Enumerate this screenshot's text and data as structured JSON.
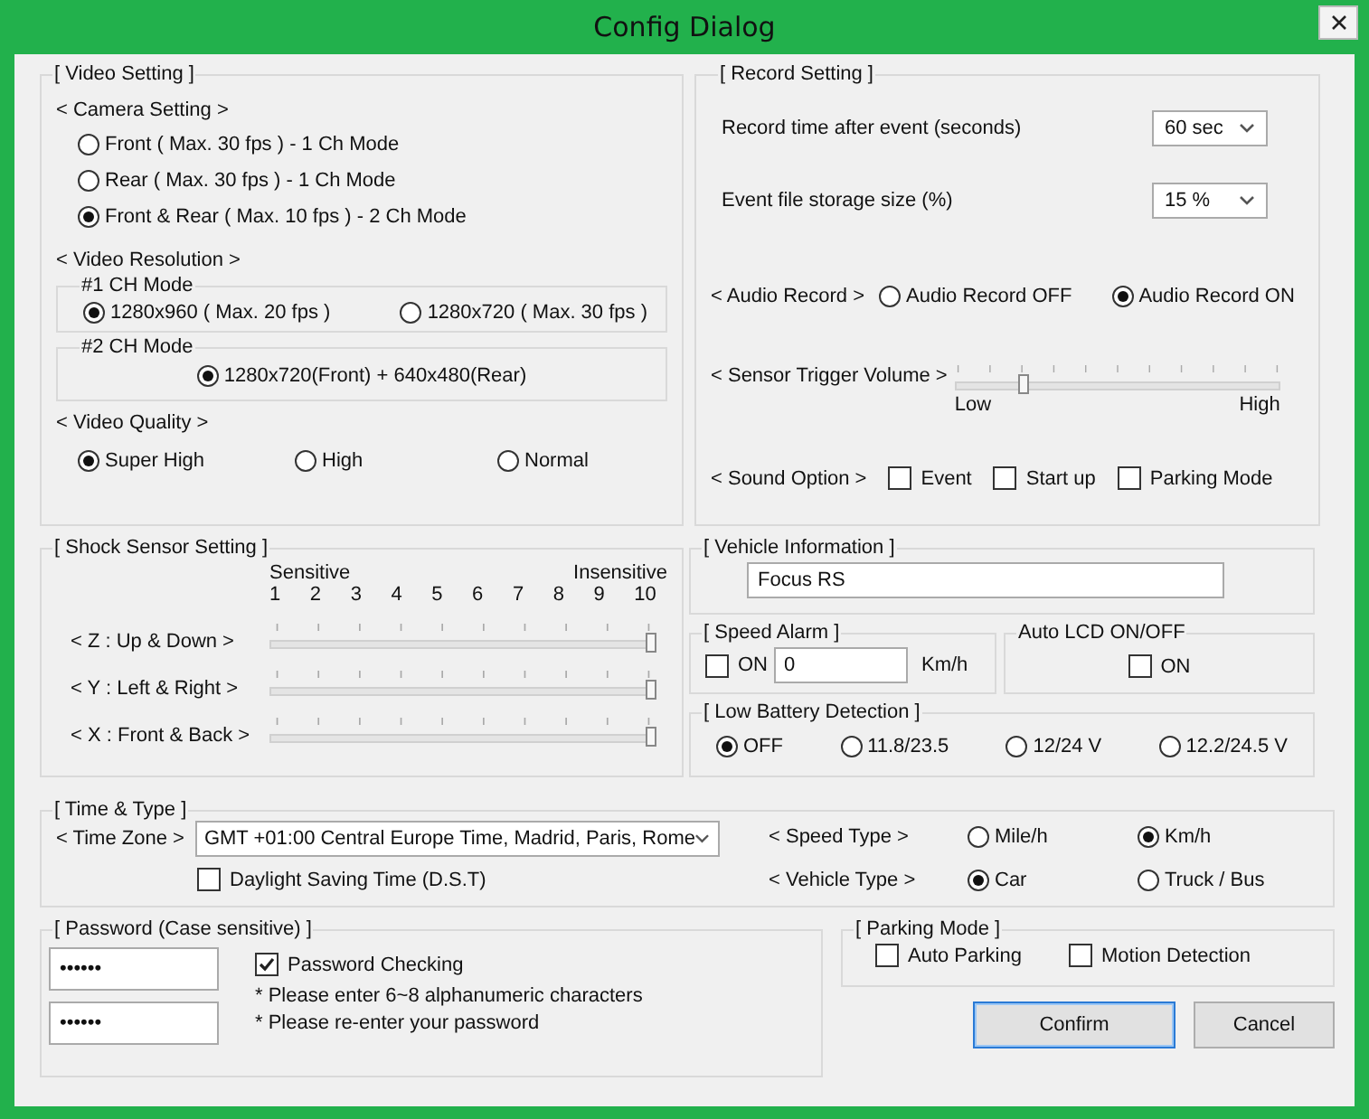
{
  "window": {
    "title": "Config Dialog"
  },
  "video_setting": {
    "title": "[ Video Setting ]",
    "camera_setting": {
      "label": "< Camera Setting >",
      "options": [
        {
          "label": "Front ( Max. 30 fps ) - 1 Ch Mode",
          "selected": false
        },
        {
          "label": "Rear  ( Max. 30 fps ) - 1  Ch Mode",
          "selected": false
        },
        {
          "label": "Front & Rear  ( Max. 10 fps ) - 2 Ch Mode",
          "selected": true
        }
      ]
    },
    "video_resolution": {
      "label": "< Video Resolution >",
      "ch1": {
        "title": "#1 CH Mode",
        "options": [
          {
            "label": "1280x960 ( Max. 20 fps )",
            "selected": true
          },
          {
            "label": "1280x720  ( Max. 30 fps )",
            "selected": false
          }
        ]
      },
      "ch2": {
        "title": "#2 CH Mode",
        "options": [
          {
            "label": "1280x720(Front) +  640x480(Rear)",
            "selected": true
          }
        ]
      }
    },
    "video_quality": {
      "label": "< Video Quality >",
      "options": [
        {
          "label": "Super High",
          "selected": true
        },
        {
          "label": "High",
          "selected": false
        },
        {
          "label": "Normal",
          "selected": false
        }
      ]
    }
  },
  "record_setting": {
    "title": "[ Record Setting ]",
    "record_time": {
      "label": "Record time after event (seconds)",
      "value": "60 sec"
    },
    "storage_size": {
      "label": "Event file storage size (%)",
      "value": "15 %"
    },
    "audio_record": {
      "label": "< Audio Record >",
      "options": [
        {
          "label": "Audio Record OFF",
          "selected": false
        },
        {
          "label": "Audio Record ON",
          "selected": true
        }
      ]
    },
    "sensor_trigger": {
      "label": "< Sensor Trigger Volume >",
      "level": 0.2,
      "min_label": "Low",
      "max_label": "High"
    },
    "sound_option": {
      "label": "< Sound Option >",
      "options": [
        {
          "label": "Event",
          "checked": false
        },
        {
          "label": "Start up",
          "checked": false
        },
        {
          "label": "Parking Mode",
          "checked": false
        }
      ]
    }
  },
  "shock_sensor": {
    "title": "[ Shock Sensor Setting ]",
    "min_label": "Sensitive",
    "max_label": "Insensitive",
    "scale": [
      "1",
      "2",
      "3",
      "4",
      "5",
      "6",
      "7",
      "8",
      "9",
      "10"
    ],
    "axes": [
      {
        "label": "< Z : Up &  Down >",
        "level": 1
      },
      {
        "label": "< Y : Left & Right >",
        "level": 1
      },
      {
        "label": "< X : Front & Back >",
        "level": 1
      }
    ]
  },
  "vehicle_information": {
    "title": "[ Vehicle Information ]",
    "value": "Focus RS"
  },
  "speed_alarm": {
    "title": "[ Speed Alarm ]",
    "checkbox": {
      "label": "ON",
      "checked": false
    },
    "value": "0",
    "unit": "Km/h"
  },
  "auto_lcd": {
    "title": "Auto LCD ON/OFF",
    "checkbox": {
      "label": "ON",
      "checked": false
    }
  },
  "low_battery": {
    "title": "[ Low Battery Detection ]",
    "options": [
      {
        "label": "OFF",
        "selected": true
      },
      {
        "label": "11.8/23.5",
        "selected": false
      },
      {
        "label": "12/24 V",
        "selected": false
      },
      {
        "label": "12.2/24.5 V",
        "selected": false
      }
    ]
  },
  "time_type": {
    "title": "[ Time & Type ]",
    "time_zone": {
      "label": "< Time Zone >",
      "value": "GMT +01:00 Central Europe Time, Madrid, Paris, Rome"
    },
    "dst": {
      "label": "Daylight Saving Time (D.S.T)",
      "checked": false
    },
    "speed_type": {
      "label": "< Speed Type >",
      "options": [
        {
          "label": "Mile/h",
          "selected": false
        },
        {
          "label": "Km/h",
          "selected": true
        }
      ]
    },
    "vehicle_type": {
      "label": "< Vehicle Type >",
      "options": [
        {
          "label": "Car",
          "selected": true
        },
        {
          "label": "Truck / Bus",
          "selected": false
        }
      ]
    }
  },
  "password": {
    "title": "[ Password (Case sensitive) ]",
    "fields": [
      "••••••",
      "••••••"
    ],
    "checkbox": {
      "label": "Password Checking",
      "checked": true
    },
    "notes": [
      "* Please enter 6~8 alphanumeric characters",
      "* Please re-enter your password"
    ]
  },
  "parking_mode": {
    "title": "[ Parking Mode ]",
    "options": [
      {
        "label": "Auto Parking",
        "checked": false
      },
      {
        "label": "Motion Detection",
        "checked": false
      }
    ]
  },
  "buttons": [
    {
      "label": "Confirm",
      "default": true
    },
    {
      "label": "Cancel",
      "default": false
    }
  ]
}
